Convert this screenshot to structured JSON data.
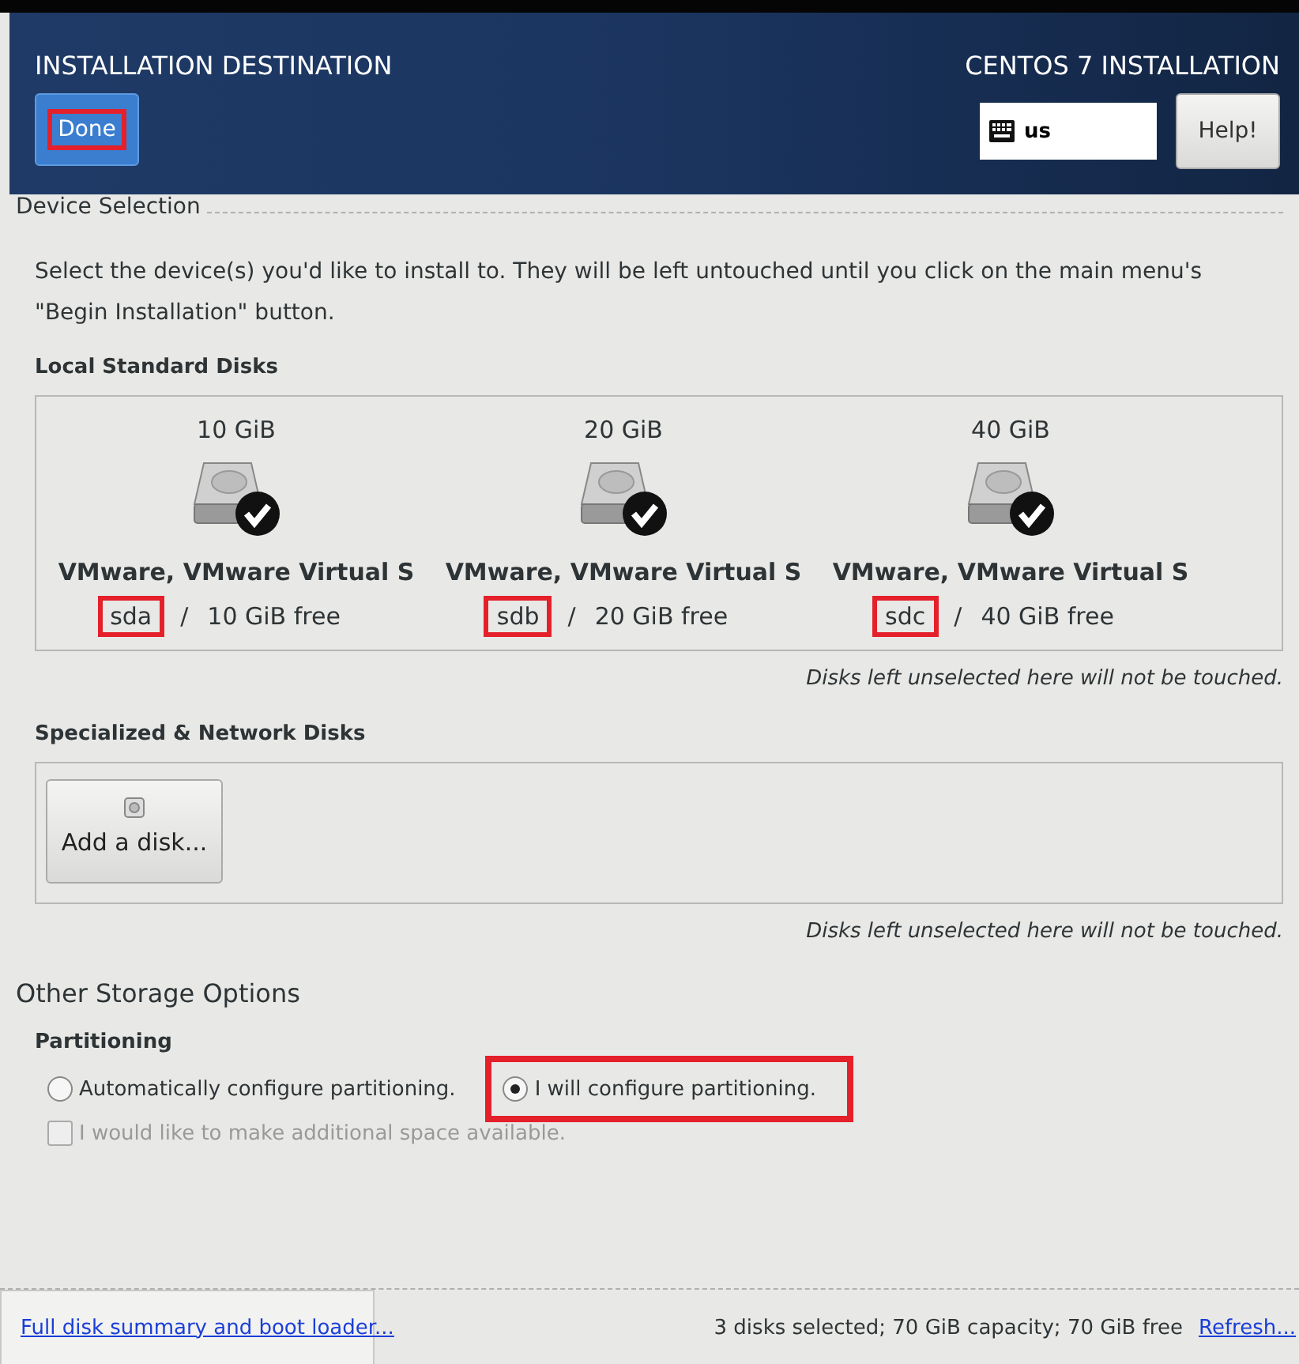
{
  "header": {
    "title": "INSTALLATION DESTINATION",
    "product": "CENTOS 7 INSTALLATION",
    "done_button": {
      "label": "Done",
      "highlighted": true
    },
    "keyboard": {
      "value": "us"
    },
    "help_button": {
      "label": "Help!"
    }
  },
  "device_selection": {
    "heading": "Device Selection",
    "description": "Select the device(s) you'd like to install to.  They will be left untouched until you click on the main menu's \"Begin Installation\" button.",
    "local_disks": {
      "heading": "Local Standard Disks",
      "separator": "/",
      "disks": [
        {
          "size": "10 GiB",
          "name": "VMware, VMware Virtual S",
          "device": "sda",
          "free": "10 GiB free",
          "selected": true,
          "highlighted": true
        },
        {
          "size": "20 GiB",
          "name": "VMware, VMware Virtual S",
          "device": "sdb",
          "free": "20 GiB free",
          "selected": true,
          "highlighted": true
        },
        {
          "size": "40 GiB",
          "name": "VMware, VMware Virtual S",
          "device": "sdc",
          "free": "40 GiB free",
          "selected": true,
          "highlighted": true
        }
      ],
      "note": "Disks left unselected here will not be touched."
    },
    "specialized_disks": {
      "heading": "Specialized & Network Disks",
      "add_button": "Add a disk...",
      "note": "Disks left unselected here will not be touched."
    }
  },
  "other_storage": {
    "heading": "Other Storage Options",
    "partitioning": {
      "heading": "Partitioning",
      "options": [
        {
          "label": "Automatically configure partitioning.",
          "selected": false,
          "highlighted": false
        },
        {
          "label": "I will configure partitioning.",
          "selected": true,
          "highlighted": true
        }
      ],
      "additional_space": {
        "label": "I would like to make additional space available.",
        "checked": false,
        "disabled": true
      }
    }
  },
  "footer": {
    "summary_link": "Full disk summary and boot loader...",
    "status": "3 disks selected; 70 GiB capacity; 70 GiB free",
    "refresh_link": "Refresh..."
  }
}
